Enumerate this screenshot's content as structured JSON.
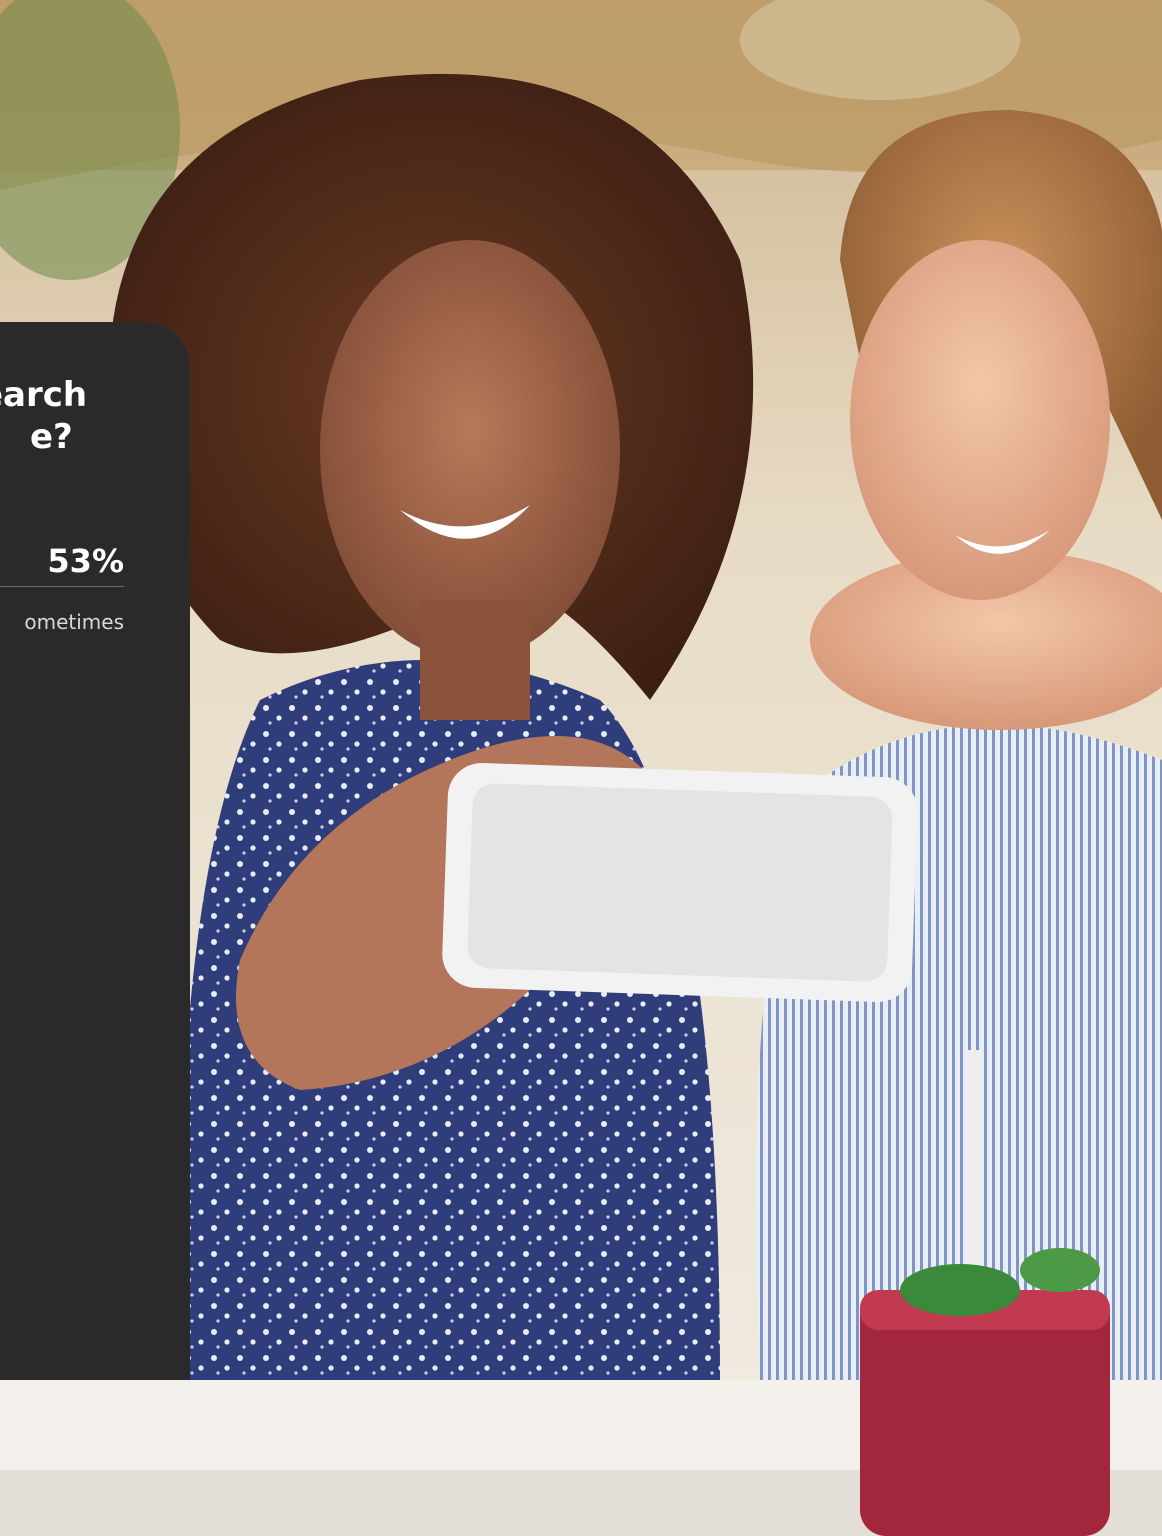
{
  "card": {
    "question_line1": "earch",
    "question_line2": "e?",
    "stat_percent": "53%",
    "stat_label": "ometimes"
  },
  "colors": {
    "card_background": "#2a2a2a",
    "card_text": "#ffffff",
    "stat_label_text": "#d8d8d8"
  }
}
